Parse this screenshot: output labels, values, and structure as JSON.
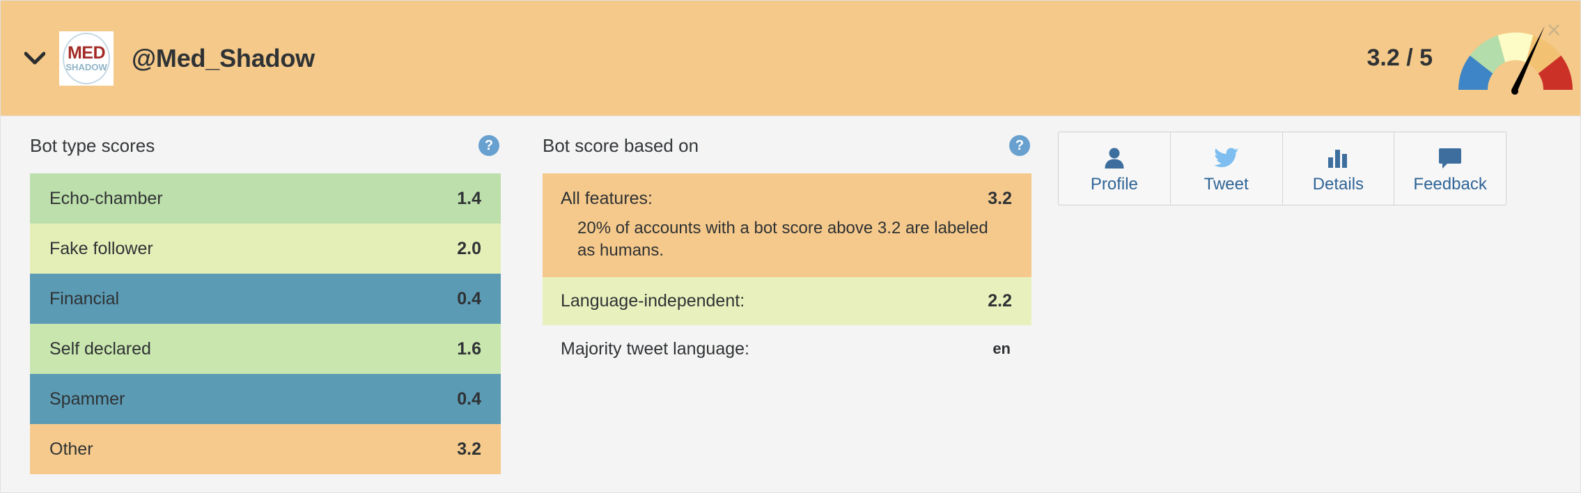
{
  "header": {
    "chevron_icon": "chevron-down-icon",
    "avatar": {
      "line1": "MED",
      "line2": "SHADOW"
    },
    "handle": "@Med_Shadow",
    "score_display": "3.2 / 5",
    "close_label": "×",
    "bg_color": "#f4c98a"
  },
  "gauge": {
    "value": 3.2,
    "max": 5,
    "segment_colors": [
      "#3d85c6",
      "#b3ddab",
      "#fdfcc6",
      "#f3c172",
      "#cc3128"
    ],
    "needle_color": "#000000",
    "hub_color": "#f0c386"
  },
  "bot_type_scores": {
    "title": "Bot type scores",
    "help_icon": "help-icon",
    "rows": [
      {
        "label": "Echo-chamber",
        "value": "1.4",
        "color": "#bddfac"
      },
      {
        "label": "Fake follower",
        "value": "2.0",
        "color": "#e4efb8"
      },
      {
        "label": "Financial",
        "value": "0.4",
        "color": "#5b9bb4"
      },
      {
        "label": "Self declared",
        "value": "1.6",
        "color": "#c9e6ae"
      },
      {
        "label": "Spammer",
        "value": "0.4",
        "color": "#5b9bb4"
      },
      {
        "label": "Other",
        "value": "3.2",
        "color": "#f5ca8c"
      }
    ]
  },
  "bot_score_based_on": {
    "title": "Bot score based on",
    "help_icon": "help-icon",
    "all_features": {
      "label": "All features:",
      "value": "3.2",
      "description": "20% of accounts with a bot score above 3.2 are labeled as humans.",
      "color": "#f5c98b"
    },
    "language_independent": {
      "label": "Language-independent:",
      "value": "2.2",
      "color": "#e8f1bd"
    },
    "majority_language": {
      "label": "Majority tweet language:",
      "value": "en"
    }
  },
  "actions": {
    "buttons": [
      {
        "label": "Profile",
        "icon": "person-icon"
      },
      {
        "label": "Tweet",
        "icon": "twitter-bird-icon"
      },
      {
        "label": "Details",
        "icon": "bar-chart-icon"
      },
      {
        "label": "Feedback",
        "icon": "speech-bubble-icon"
      }
    ],
    "accent_color": "#2f6496"
  }
}
